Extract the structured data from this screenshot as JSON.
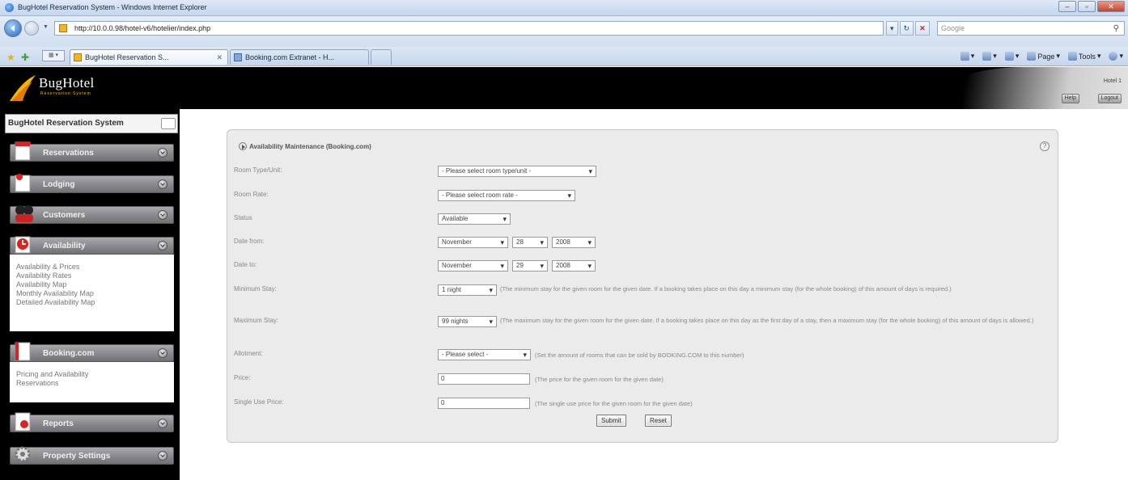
{
  "browser": {
    "window_title": "BugHotel Reservation System - Windows Internet Explorer",
    "url": "http://10.0.0.98/hotel-v6/hotelier/index.php",
    "search_placeholder": "Google",
    "tabs": [
      {
        "label": "BugHotel Reservation S...",
        "active": true
      },
      {
        "label": "Booking.com Extranet - H...",
        "active": false
      }
    ],
    "commands": {
      "page": "Page",
      "tools": "Tools"
    }
  },
  "header": {
    "logo_title": "BugHotel",
    "logo_subtitle": "Reservation System",
    "hotel_name": "Hotel 1",
    "help_label": "Help",
    "logout_label": "Logout"
  },
  "sidebar": {
    "system_title": "BugHotel Reservation System",
    "items": [
      {
        "label": "Reservations"
      },
      {
        "label": "Lodging"
      },
      {
        "label": "Customers"
      },
      {
        "label": "Availability",
        "links": [
          "Availability & Prices",
          "Availability Rates",
          "Availability Map",
          "Monthly Availability Map",
          "Detailed Availability Map"
        ]
      },
      {
        "label": "Booking.com",
        "links": [
          "Pricing and Availability",
          "Reservations"
        ]
      },
      {
        "label": "Reports"
      },
      {
        "label": "Property Settings"
      }
    ]
  },
  "form": {
    "title": "Availability Maintenance (Booking.com)",
    "help_icon": "?",
    "room_type": {
      "label": "Room Type/Unit:",
      "value": "- Please select room type/unit -"
    },
    "room_rate": {
      "label": "Room Rate:",
      "value": "- Please select room rate -"
    },
    "status": {
      "label": "Status",
      "value": "Available"
    },
    "date_from": {
      "label": "Date from:",
      "month": "November",
      "day": "28",
      "year": "2008"
    },
    "date_to": {
      "label": "Date to:",
      "month": "November",
      "day": "29",
      "year": "2008"
    },
    "min_stay": {
      "label": "Minimum Stay:",
      "value": "1 night",
      "hint": "(The minimum stay for the given room for the given date. If a booking takes place on this day a minimum stay (for the whole booking) of this amount of days is required.)"
    },
    "max_stay": {
      "label": "Maximum Stay:",
      "value": "99 nights",
      "hint": "(The maximum stay for the given room for the given date. If a booking takes place on this day as the first day of a stay, then a maximum stay (for the whole booking) of this amount of days is allowed.)"
    },
    "allotment": {
      "label": "Allotment:",
      "value": "- Please select -",
      "hint": "(Set the amount of rooms that can be sold by BOOKING.COM to this number)"
    },
    "price": {
      "label": "Price:",
      "value": "0",
      "hint": "(The price for the given room for the given date)"
    },
    "single_price": {
      "label": "Single Use Price:",
      "value": "0",
      "hint": "(The single use price for the given room for the given date)"
    },
    "submit_label": "Submit",
    "reset_label": "Reset"
  }
}
